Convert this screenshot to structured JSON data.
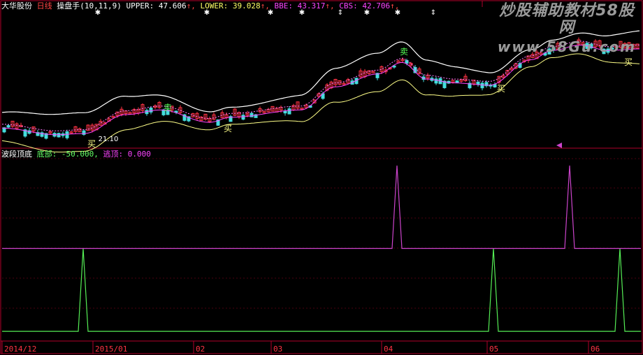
{
  "header": {
    "stock": "大华股份",
    "period": "日线",
    "indicator": "操盘手",
    "params": "(10,11,9)",
    "items": [
      {
        "label": "UPPER:",
        "value": "47.606",
        "color": "#ffffff"
      },
      {
        "label": "LOWER:",
        "value": "39.028",
        "color": "#ffff66"
      },
      {
        "label": "BBE:",
        "value": "43.317",
        "color": "#ff44ff"
      },
      {
        "label": "CBS:",
        "value": "42.706",
        "color": "#ff44ff"
      }
    ]
  },
  "watermark": {
    "line1": "炒股辅助教材58股网",
    "line2": "www.58Gu.com"
  },
  "lower_header": {
    "name": "波段顶底",
    "items": [
      {
        "label": "底部:",
        "value": "-50.000",
        "color": "#66ff66"
      },
      {
        "label": "逃顶:",
        "value": "0.000",
        "color": "#ff44ff"
      }
    ]
  },
  "colors": {
    "up": "#ff3344",
    "down": "#44dddd",
    "upper": "#ffffff",
    "lower": "#ffff88",
    "mid": "#ff44ff",
    "bottom": "#55ee55",
    "top": "#cc44cc",
    "frame": "#b0002a"
  },
  "chart_data": [
    {
      "type": "candlestick",
      "title": "操盘手(10,11,9)",
      "annotations": [
        {
          "text": "卖",
          "color": "#55ff55"
        },
        {
          "text": "卖",
          "color": "#55ff55"
        },
        {
          "text": "买",
          "color": "#ffff88"
        },
        {
          "text": "买",
          "color": "#ffff88"
        },
        {
          "text": "买",
          "color": "#ffff88"
        },
        {
          "text": "买",
          "color": "#ffff88"
        },
        {
          "text": "21.10",
          "color": "#ffffff"
        }
      ],
      "price_range": [
        18,
        52
      ],
      "legend": [
        "UPPER",
        "LOWER",
        "BBE",
        "CBS"
      ]
    },
    {
      "type": "line",
      "title": "波段顶底",
      "x_ticks": [
        "2014/12",
        "2015/01",
        "02",
        "03",
        "04",
        "05",
        "06"
      ],
      "series": [
        {
          "name": "底部",
          "baseline": -50,
          "peak": 0,
          "peak_positions": [
            119,
            706,
            887
          ]
        },
        {
          "name": "逃顶",
          "baseline": 0,
          "peak": 50,
          "peak_positions": [
            568,
            815
          ]
        }
      ],
      "ylim": [
        -55,
        55
      ]
    }
  ]
}
